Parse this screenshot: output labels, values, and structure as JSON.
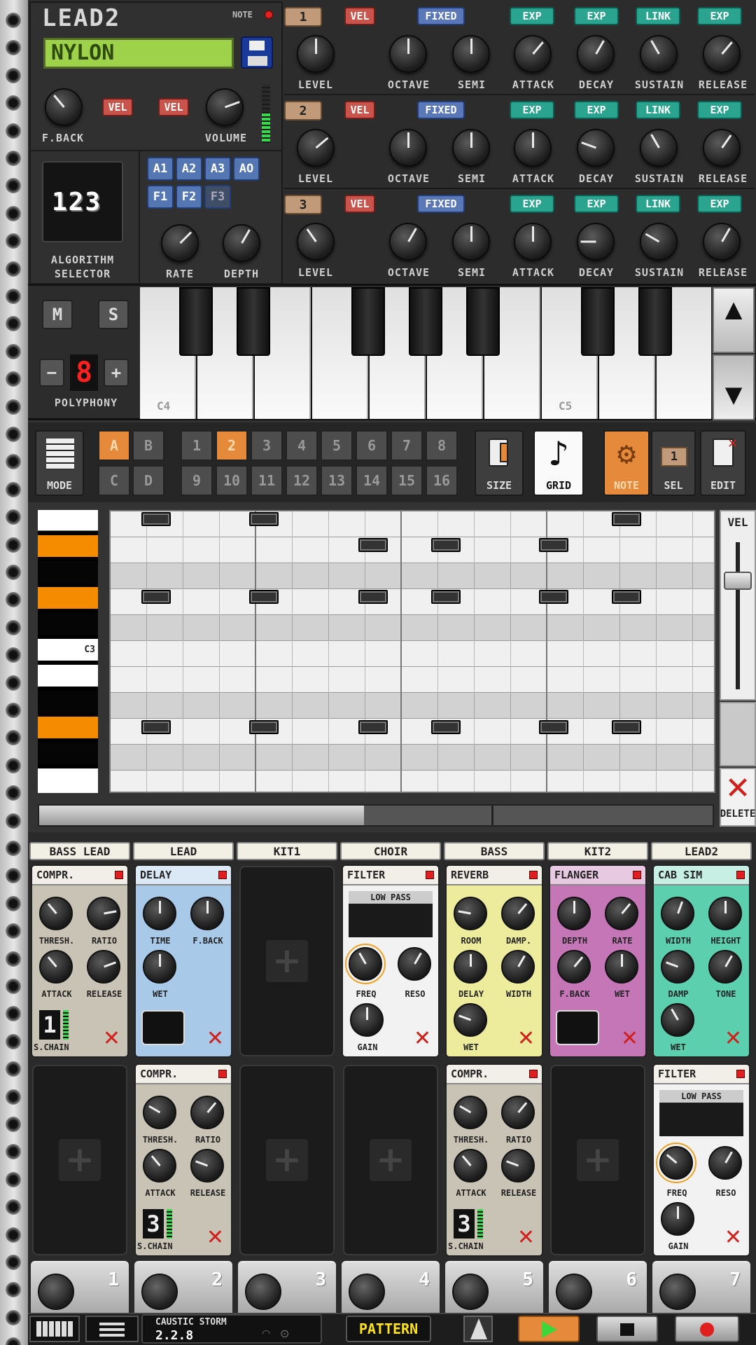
{
  "synth": {
    "name": "LEAD2",
    "note_label": "NOTE",
    "preset": "NYLON",
    "fback_label": "F.BACK",
    "vel_label": "VEL",
    "volume_label": "VOLUME"
  },
  "algorithm": {
    "display": "123",
    "label_line1": "ALGORITHM",
    "label_line2": "SELECTOR",
    "buttons": [
      "A1",
      "A2",
      "A3",
      "AO",
      "F1",
      "F2",
      "F3"
    ],
    "rate_label": "RATE",
    "depth_label": "DEPTH"
  },
  "operators": [
    {
      "num": "1",
      "vel": "VEL",
      "fixed": "FIXED",
      "exp1": "EXP",
      "exp2": "EXP",
      "link": "LINK",
      "exp3": "EXP",
      "labels": [
        "LEVEL",
        "OCTAVE",
        "SEMI",
        "ATTACK",
        "DECAY",
        "SUSTAIN",
        "RELEASE"
      ]
    },
    {
      "num": "2",
      "vel": "VEL",
      "fixed": "FIXED",
      "exp1": "EXP",
      "exp2": "EXP",
      "link": "LINK",
      "exp3": "EXP",
      "labels": [
        "LEVEL",
        "OCTAVE",
        "SEMI",
        "ATTACK",
        "DECAY",
        "SUSTAIN",
        "RELEASE"
      ]
    },
    {
      "num": "3",
      "vel": "VEL",
      "fixed": "FIXED",
      "exp1": "EXP",
      "exp2": "EXP",
      "link": "LINK",
      "exp3": "EXP",
      "labels": [
        "LEVEL",
        "OCTAVE",
        "SEMI",
        "ATTACK",
        "DECAY",
        "SUSTAIN",
        "RELEASE"
      ]
    }
  ],
  "keyboard": {
    "m": "M",
    "s": "S",
    "minus": "−",
    "plus": "+",
    "poly_value": "8",
    "poly_label": "POLYPHONY",
    "c4": "C4",
    "c5": "C5",
    "up": "▲",
    "down": "▼"
  },
  "seqbar": {
    "mode": "MODE",
    "banks": [
      "A",
      "B",
      "C",
      "D"
    ],
    "patterns_row1": [
      "1",
      "2",
      "3",
      "4",
      "5",
      "6",
      "7",
      "8"
    ],
    "patterns_row2": [
      "9",
      "10",
      "11",
      "12",
      "13",
      "14",
      "15",
      "16"
    ],
    "size": "SIZE",
    "grid": "GRID",
    "note": "NOTE",
    "sel": "SEL",
    "sel_value": "1",
    "edit": "EDIT"
  },
  "roll": {
    "c3": "C3",
    "vel": "VEL",
    "delete": "DELETE"
  },
  "tracks": [
    "BASS LEAD",
    "LEAD",
    "KIT1",
    "CHOIR",
    "BASS",
    "KIT2",
    "LEAD2"
  ],
  "effects": {
    "compr": {
      "title": "COMPR.",
      "labels": [
        "THRESH.",
        "RATIO",
        "ATTACK",
        "RELEASE"
      ],
      "chain": "S.CHAIN",
      "chain_value1": "1",
      "chain_value3": "3"
    },
    "delay": {
      "title": "DELAY",
      "labels": [
        "TIME",
        "F.BACK",
        "WET"
      ]
    },
    "filter": {
      "title": "FILTER",
      "mode": "LOW PASS",
      "labels": [
        "FREQ",
        "RESO",
        "GAIN"
      ]
    },
    "reverb": {
      "title": "REVERB",
      "labels": [
        "ROOM",
        "DAMP.",
        "DELAY",
        "WIDTH",
        "WET"
      ]
    },
    "flanger": {
      "title": "FLANGER",
      "labels": [
        "DEPTH",
        "RATE",
        "F.BACK",
        "WET"
      ]
    },
    "cabsim": {
      "title": "CAB SIM",
      "labels": [
        "WIDTH",
        "HEIGHT",
        "DAMP",
        "TONE",
        "WET"
      ]
    }
  },
  "mixer": [
    "1",
    "2",
    "3",
    "4",
    "5",
    "6",
    "7"
  ],
  "bottombar": {
    "song_name": "CAUSTIC STORM",
    "version": "2.2.8",
    "pattern": "PATTERN"
  },
  "colors": {
    "orange": "#e58a3b",
    "lcd": "#9ed24a",
    "vel": "#c9544b",
    "fixed": "#5a77b8",
    "exp": "#2aa38f"
  }
}
